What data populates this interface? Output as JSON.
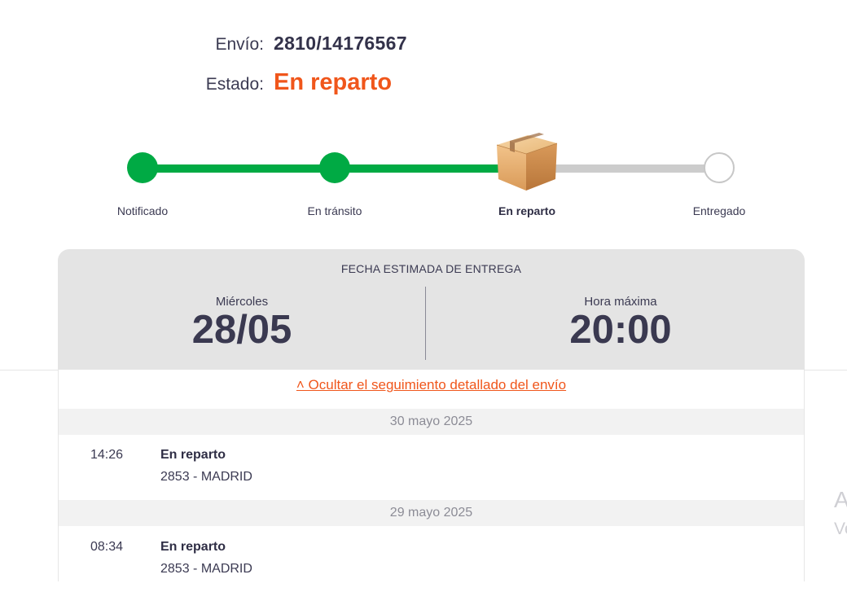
{
  "header": {
    "envio_label": "Envío:",
    "envio_value": "2810/14176567",
    "estado_label": "Estado:",
    "estado_value": "En reparto"
  },
  "tracker": {
    "steps": [
      {
        "label": "Notificado",
        "state": "done"
      },
      {
        "label": "En tránsito",
        "state": "done"
      },
      {
        "label": "En reparto",
        "state": "current"
      },
      {
        "label": "Entregado",
        "state": "pending"
      }
    ],
    "current_icon": "package-box-icon"
  },
  "estimate": {
    "title": "FECHA ESTIMADA DE ENTREGA",
    "day_label": "Miércoles",
    "date": "28/05",
    "time_label": "Hora máxima",
    "time": "20:00"
  },
  "details": {
    "toggle_label": "˄ Ocultar el seguimiento detallado del envío",
    "days": [
      {
        "date": "30 mayo 2025",
        "events": [
          {
            "time": "14:26",
            "status": "En reparto",
            "place": "2853 - MADRID"
          }
        ]
      },
      {
        "date": "29 mayo 2025",
        "events": [
          {
            "time": "08:34",
            "status": "En reparto",
            "place": "2853 - MADRID"
          }
        ]
      }
    ]
  },
  "side_partial": {
    "letter1": "A",
    "letter2": "Ve"
  },
  "colors": {
    "accent": "#f0561b",
    "progress_done": "#00aa44",
    "progress_pending": "#cccccc",
    "text": "#3b3a52"
  }
}
